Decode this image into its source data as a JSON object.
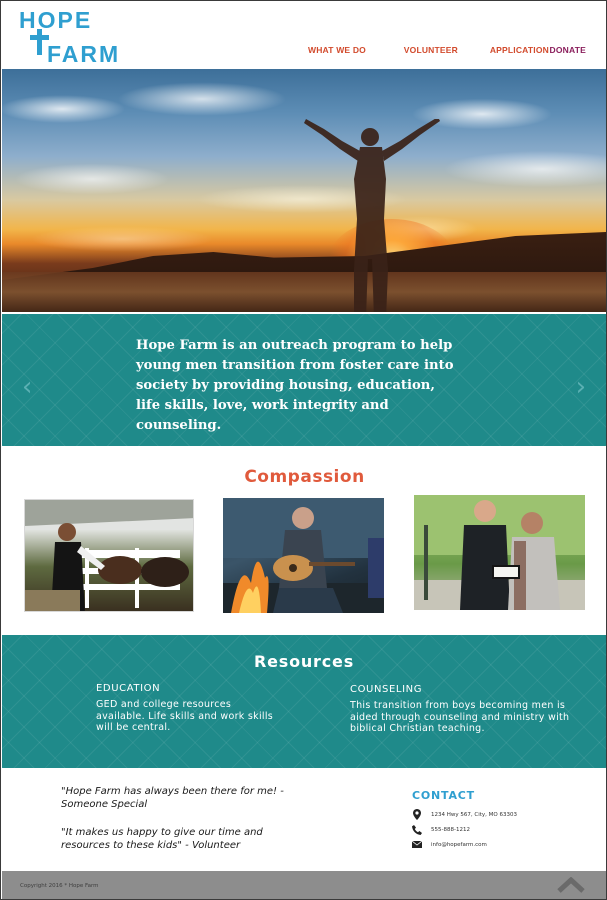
{
  "brand": {
    "line1": "HOPE",
    "line2": "FARM",
    "color": "#2f9fd0"
  },
  "nav": {
    "items": [
      {
        "label": "WHAT WE DO"
      },
      {
        "label": "VOLUNTEER"
      },
      {
        "label": "APPLICATION"
      },
      {
        "label": "DONATE"
      }
    ],
    "color": "#d24a2c",
    "donate_color": "#8a1e5c"
  },
  "mission": {
    "text": "Hope Farm is an outreach program to help young men transition from foster care into society by providing housing, education, life skills, love, work integrity and counseling.",
    "prev_arrow": "‹",
    "next_arrow": "›"
  },
  "compassion": {
    "title": "Compassion",
    "color": "#e05a3c"
  },
  "resources": {
    "title": "Resources",
    "education": {
      "heading": "EDUCATION",
      "body": "GED and college resources available.  Life skills and work skills will be central."
    },
    "counseling": {
      "heading": "COUNSELING",
      "body": "This transition from boys becoming men is aided through counseling and ministry with biblical Christian teaching."
    }
  },
  "quotes": [
    "\"Hope Farm has always been there for me! - Someone Special",
    "\"It makes us happy to give our time and resources to these kids\" - Volunteer"
  ],
  "contact": {
    "title": "CONTACT",
    "address": "1234 Hwy 567, City, MO 63303",
    "phone": "555-888-1212",
    "email": "info@hopefarm.com"
  },
  "footer": {
    "copyright": "Copyright 2016 * Hope Farm"
  },
  "colors": {
    "teal": "#1f8a8a",
    "accent_blue": "#2f9fd0"
  }
}
